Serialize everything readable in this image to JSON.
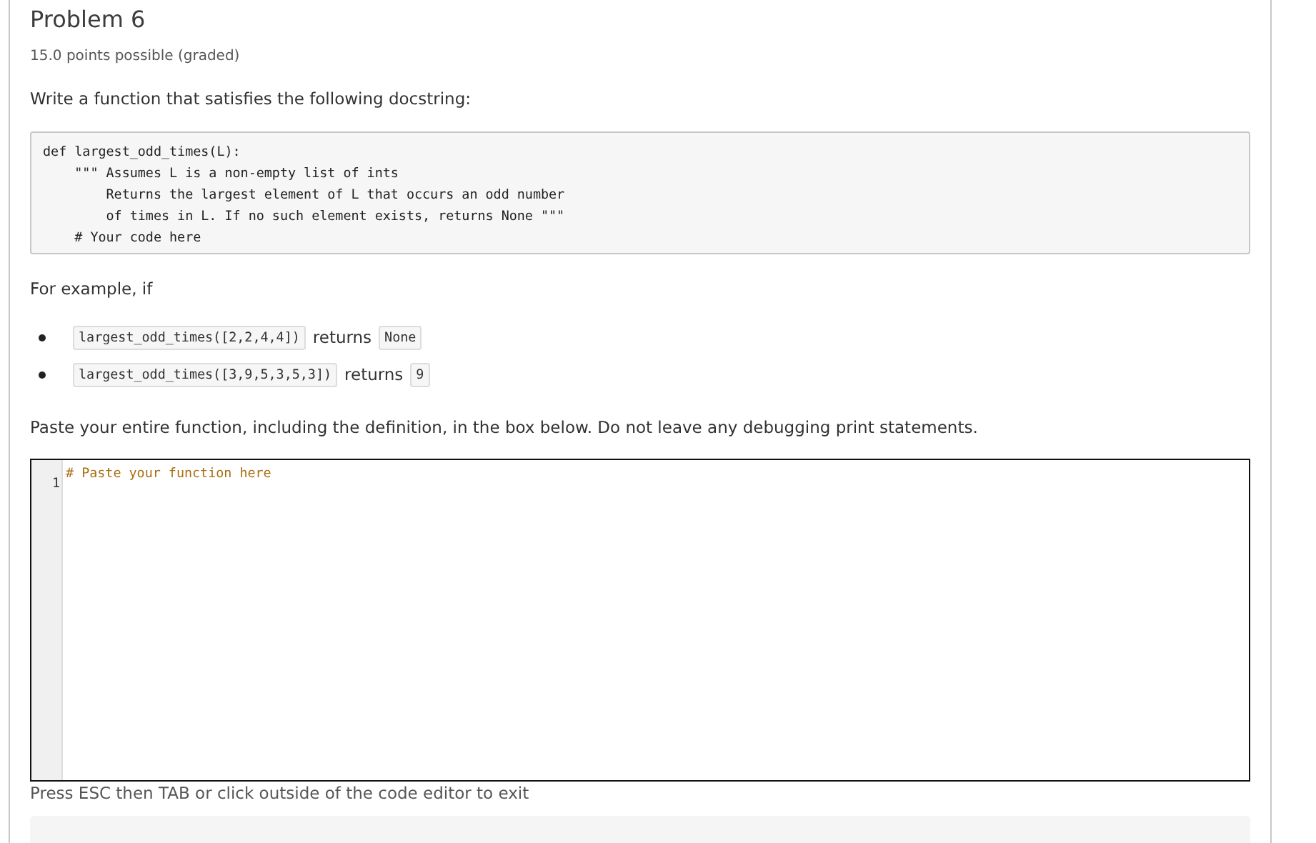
{
  "problem": {
    "title": "Problem 6",
    "points": "15.0 points possible (graded)",
    "prompt": "Write a function that satisfies the following docstring:",
    "docstring_code": [
      "def largest_odd_times(L):",
      "    \"\"\" Assumes L is a non-empty list of ints",
      "        Returns the largest element of L that occurs an odd number",
      "        of times in L. If no such element exists, returns None \"\"\"",
      "    # Your code here"
    ],
    "example_intro": "For example, if",
    "examples": [
      {
        "call": "largest_odd_times([2,2,4,4])",
        "word": "returns",
        "result": "None"
      },
      {
        "call": "largest_odd_times([3,9,5,3,5,3])",
        "word": "returns",
        "result": "9"
      }
    ],
    "instructions": "Paste your entire function, including the definition, in the box below. Do not leave any debugging print statements.",
    "editor": {
      "line_number": "1",
      "content": "# Paste your function here"
    },
    "editor_hint": "Press ESC then TAB or click outside of the code editor to exit"
  }
}
